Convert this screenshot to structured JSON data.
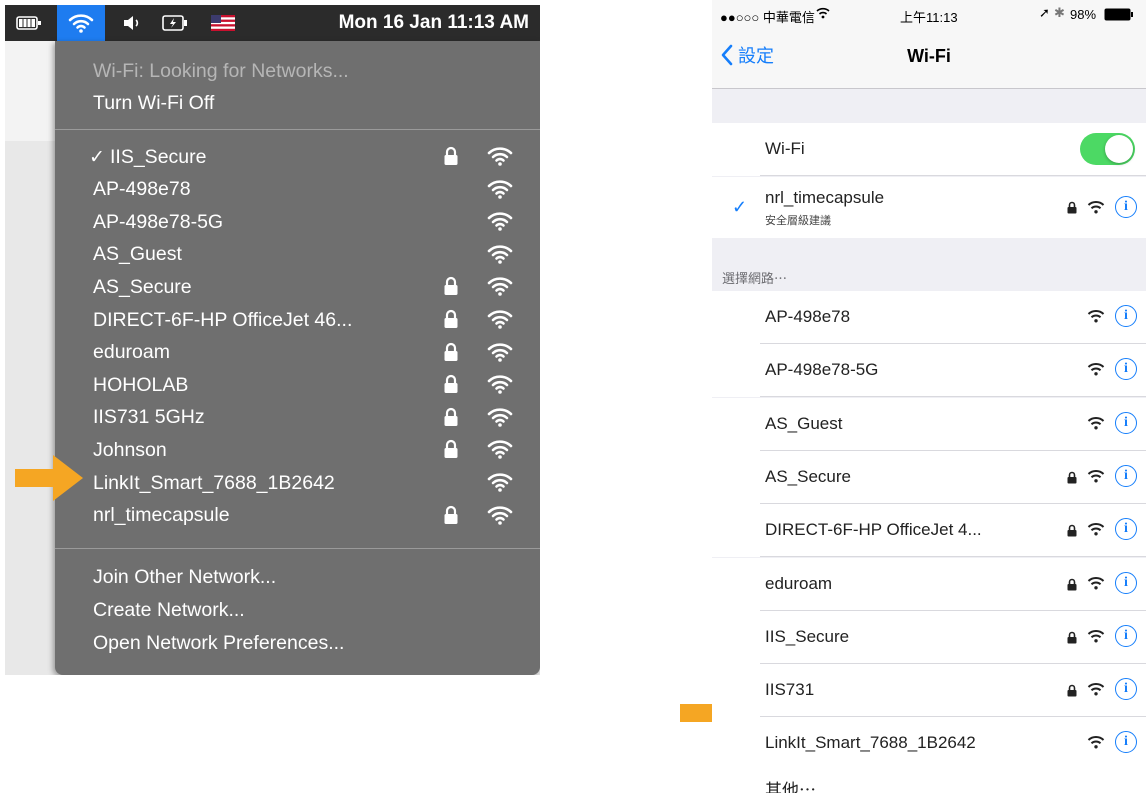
{
  "mac": {
    "menubar": {
      "clock": "Mon 16 Jan  11:13 AM"
    },
    "menu": {
      "status": "Wi-Fi: Looking for Networks...",
      "toggle": "Turn Wi-Fi Off",
      "networks": [
        {
          "name": "IIS_Secure",
          "checked": true,
          "locked": true
        },
        {
          "name": "AP-498e78",
          "checked": false,
          "locked": false
        },
        {
          "name": "AP-498e78-5G",
          "checked": false,
          "locked": false
        },
        {
          "name": "AS_Guest",
          "checked": false,
          "locked": false
        },
        {
          "name": "AS_Secure",
          "checked": false,
          "locked": true
        },
        {
          "name": "DIRECT-6F-HP OfficeJet 46...",
          "checked": false,
          "locked": true
        },
        {
          "name": "eduroam",
          "checked": false,
          "locked": true
        },
        {
          "name": "HOHOLAB",
          "checked": false,
          "locked": true
        },
        {
          "name": "IIS731 5GHz",
          "checked": false,
          "locked": true
        },
        {
          "name": "Johnson",
          "checked": false,
          "locked": true
        },
        {
          "name": "LinkIt_Smart_7688_1B2642",
          "checked": false,
          "locked": false
        },
        {
          "name": "nrl_timecapsule",
          "checked": false,
          "locked": true
        }
      ],
      "checkmark": "✓",
      "actions": [
        "Join Other Network...",
        "Create Network...",
        "Open Network Preferences..."
      ]
    }
  },
  "ios": {
    "statusbar": {
      "carrier": "●●○○○ 中華電信 ",
      "time": "上午11:13",
      "battery": "98%"
    },
    "navbar": {
      "back": "設定",
      "title": "Wi-Fi"
    },
    "wifi_toggle": {
      "label": "Wi-Fi",
      "on": true
    },
    "connected": {
      "name": "nrl_timecapsule",
      "subtitle": "安全層級建議"
    },
    "section_header": "選擇網路⋯",
    "networks": [
      {
        "name": "AP-498e78",
        "locked": false
      },
      {
        "name": "AP-498e78-5G",
        "locked": false
      },
      {
        "name": "AS_Guest",
        "locked": false
      },
      {
        "name": "AS_Secure",
        "locked": true
      },
      {
        "name": "DIRECT-6F-HP OfficeJet 4...",
        "locked": true
      },
      {
        "name": "eduroam",
        "locked": true
      },
      {
        "name": "IIS_Secure",
        "locked": true
      },
      {
        "name": "IIS731",
        "locked": true
      },
      {
        "name": "LinkIt_Smart_7688_1B2642",
        "locked": false
      }
    ],
    "other": "其他⋯",
    "info_glyph": "i"
  },
  "colors": {
    "accent": "#157efb",
    "arrow": "#f5a623",
    "toggle_on": "#4cd964",
    "menu_bg": "#6f6f6f"
  }
}
